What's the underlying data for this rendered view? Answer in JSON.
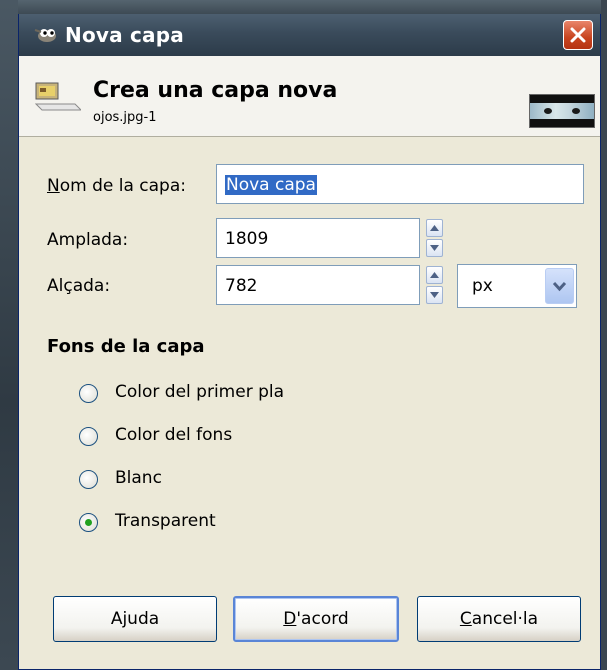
{
  "window": {
    "title": "Nova capa"
  },
  "header": {
    "title": "Crea una capa nova",
    "subtitle": "ojos.jpg-1"
  },
  "form": {
    "name_label_accel": "N",
    "name_label_rest": "om de la capa:",
    "name_value": "Nova capa",
    "width_label": "Amplada:",
    "width_value": "1809",
    "height_label": "Alçada:",
    "height_value": "782",
    "unit_value": "px"
  },
  "fill": {
    "section_title": "Fons de la capa",
    "options": [
      {
        "label": "Color del primer pla",
        "selected": false
      },
      {
        "label": "Color del fons",
        "selected": false
      },
      {
        "label": "Blanc",
        "selected": false
      },
      {
        "label": "Transparent",
        "selected": true
      }
    ]
  },
  "buttons": {
    "help": "Ajuda",
    "ok_accel": "D",
    "ok_rest": "'acord",
    "cancel_accel": "C",
    "cancel_rest": "ancel·la"
  },
  "colors": {
    "titlebar": "#3a4b5b",
    "accent_selection": "#316ac5",
    "radio_dot": "#21a121",
    "close": "#c8441f"
  },
  "icons": [
    "gimp-wilber-icon",
    "close-icon",
    "new-layer-icon",
    "image-thumbnail",
    "spin-up-icon",
    "spin-down-icon",
    "chevron-down-icon"
  ]
}
